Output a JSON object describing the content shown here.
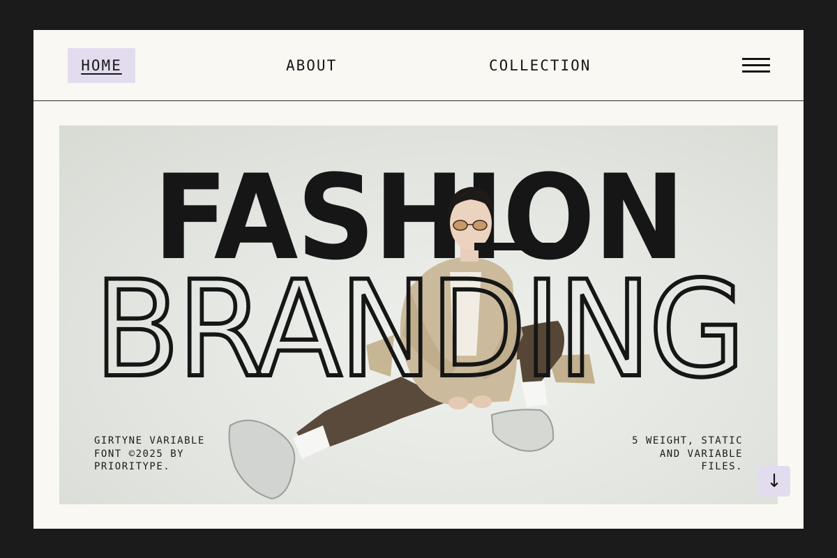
{
  "nav": {
    "home_label": "HOME",
    "about_label": "ABOUT",
    "collection_label": "COLLECTION",
    "menu_icon": "hamburger-menu-icon"
  },
  "hero": {
    "headline_line1": "FASHION",
    "headline_line2": "BRANDING",
    "photo": "model-seated-trench-coat-sneakers-sunglasses",
    "caption_left": "GIRTYNE VARIABLE\nFONT ©2025 BY\nPRIORITYPE.",
    "caption_right": "5 WEIGHT, STATIC\nAND VARIABLE\nFILES."
  },
  "scroll_button": {
    "icon": "arrow-down-icon",
    "glyph": "↓"
  },
  "colors": {
    "outer_background": "#1b1b1b",
    "page_background": "#faf8f3",
    "accent_lavender": "#e3dcef",
    "text": "#161616",
    "hero_background": "#e3e6e0",
    "coat": "#cbbb9c",
    "pants": "#5a4a3c"
  }
}
